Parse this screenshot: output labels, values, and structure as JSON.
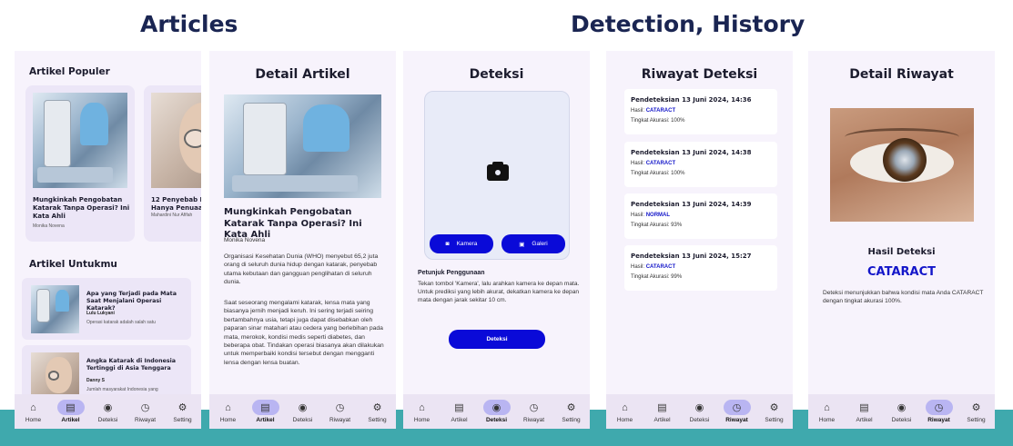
{
  "sections": {
    "articles": "Articles",
    "detection": "Detection, History"
  },
  "colors": {
    "accent": "#0a0ad8",
    "nav_active": "#b9b5f2",
    "band": "#3fa9ad",
    "screen_bg": "#f7f3fc"
  },
  "nav": {
    "items": [
      {
        "label": "Home",
        "icon": "home-icon"
      },
      {
        "label": "Artikel",
        "icon": "article-icon"
      },
      {
        "label": "Deteksi",
        "icon": "eye-icon"
      },
      {
        "label": "Riwayat",
        "icon": "history-icon"
      },
      {
        "label": "Setting",
        "icon": "gear-icon"
      }
    ]
  },
  "screen1": {
    "popular_heading": "Artikel Populer",
    "popular_cards": [
      {
        "title": "Mungkinkah Pengobatan Katarak Tanpa Operasi? Ini Kata Ahli",
        "author": "Monika Novena"
      },
      {
        "title": "12 Penyebab Katarak Tak Hanya Penuaan",
        "author": "Mahardini Nur Afifah"
      }
    ],
    "foryou_heading": "Artikel Untukmu",
    "foryou_cards": [
      {
        "title": "Apa yang Terjadi pada Mata Saat Menjalani Operasi Katarak?",
        "author": "Lulu Lukyani",
        "snippet": "Operasi katarak adalah salah satu"
      },
      {
        "title": "Angka Katarak di Indonesia Tertinggi di Asia Tenggara",
        "author": "Danny S",
        "snippet": "Jumlah masyarakat Indonesia yang"
      }
    ]
  },
  "screen2": {
    "title": "Detail Artikel",
    "article_title": "Mungkinkah Pengobatan Katarak Tanpa Operasi? Ini Kata Ahli",
    "author": "Monika Novena",
    "para1": "Organisasi Kesehatan Dunia (WHO) menyebut 65,2 juta orang di seluruh dunia hidup dengan katarak, penyebab utama kebutaan dan gangguan penglihatan di seluruh dunia.",
    "para2": "Saat seseorang mengalami katarak, lensa mata yang biasanya jernih menjadi keruh. Ini sering terjadi seiring bertambahnya usia, tetapi juga dapat disebabkan oleh paparan sinar matahari atau cedera yang berlebihan pada mata, merokok, kondisi medis seperti diabetes, dan beberapa obat. Tindakan operasi biasanya akan dilakukan untuk memperbaiki kondisi tersebut dengan mengganti lensa dengan lensa buatan."
  },
  "screen3": {
    "title": "Deteksi",
    "camera_label": "Kamera",
    "gallery_label": "Galeri",
    "guide_heading": "Petunjuk Penggunaan",
    "guide_text": "Tekan tombol 'Kamera', lalu arahkan kamera ke depan mata. Untuk prediksi yang lebih akurat, dekatkan kamera ke depan mata dengan jarak sekitar 10 cm.",
    "detect_label": "Deteksi"
  },
  "screen4": {
    "title": "Riwayat Deteksi",
    "result_label": "Hasil:",
    "accuracy_label": "Tingkat Akurasi:",
    "entries": [
      {
        "title": "Pendeteksian 13 Juni 2024, 14:36",
        "result": "CATARACT",
        "accuracy": "100%"
      },
      {
        "title": "Pendeteksian 13 Juni 2024, 14:38",
        "result": "CATARACT",
        "accuracy": "100%"
      },
      {
        "title": "Pendeteksian 13 Juni 2024, 14:39",
        "result": "NORMAL",
        "accuracy": "93%"
      },
      {
        "title": "Pendeteksian 13 Juni 2024, 15:27",
        "result": "CATARACT",
        "accuracy": "99%"
      }
    ]
  },
  "screen5": {
    "title": "Detail Riwayat",
    "result_heading": "Hasil Deteksi",
    "result_value": "CATARACT",
    "description": "Deteksi menunjukkan bahwa kondisi mata Anda CATARACT dengan tingkat akurasi 100%."
  }
}
